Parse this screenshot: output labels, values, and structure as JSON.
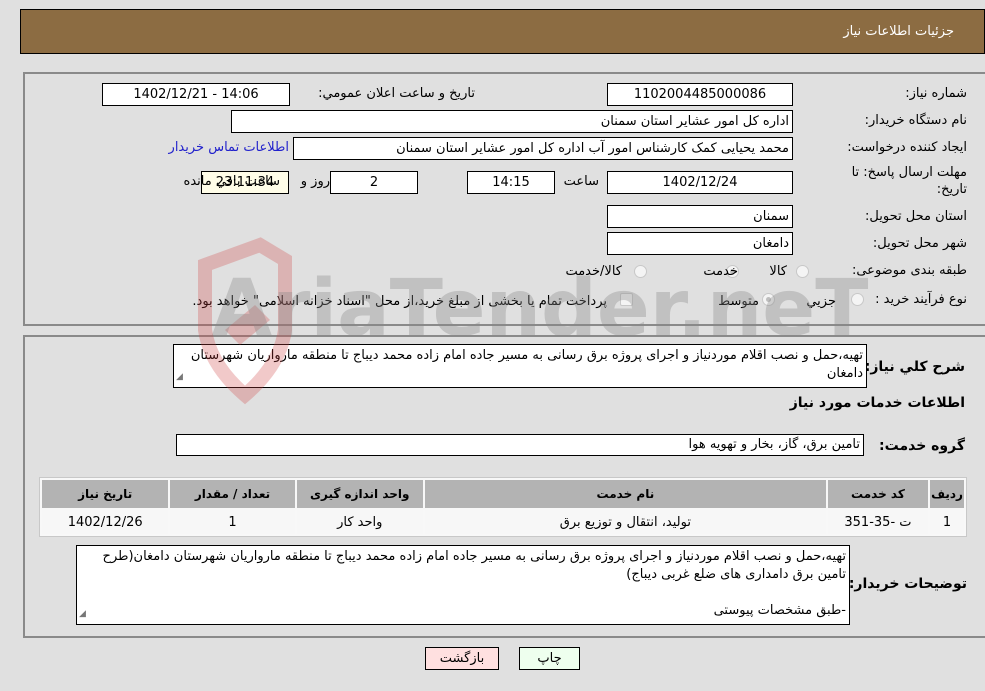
{
  "header": {
    "title": "جزئیات اطلاعات نیاز"
  },
  "colors": {
    "header_bg": "#8c6c42",
    "page_bg": "#e0e0e0",
    "link": "#2222cc",
    "back_button_bg": "#ffe0e0",
    "print_button_bg": "#eeffee",
    "remaining_time_bg": "#fffde8"
  },
  "details": {
    "need_number_label": "شماره نیاز:",
    "need_number": "1102004485000086",
    "announce_label": "تاریخ و ساعت اعلان عمومي:",
    "announce_value": "1402/12/21 - 14:06",
    "buyer_org_label": "نام دستگاه خریدار:",
    "buyer_org": "اداره کل امور عشایر استان سمنان",
    "creator_label": "ایجاد کننده درخواست:",
    "creator": "محمد یحیایی کمک کارشناس امور آب اداره کل امور عشایر استان سمنان",
    "contact_link": "اطلاعات تماس خریدار",
    "deadline_label": "مهلت ارسال پاسخ: تا تاریخ:",
    "deadline_date": "1402/12/24",
    "time_label": "ساعت",
    "deadline_time": "14:15",
    "days": "2",
    "days_label": "روز و",
    "remaining": "23:11:34",
    "remaining_label": "ساعت باقي مانده",
    "province_label": "استان محل تحویل:",
    "province": "سمنان",
    "city_label": "شهر محل تحویل:",
    "city": "دامغان",
    "category_label": "طبقه بندی موضوعی:",
    "category_options": [
      {
        "label": "کالا",
        "checked": false
      },
      {
        "label": "خدمت",
        "checked": true
      },
      {
        "label": "کالا/خدمت",
        "checked": false
      }
    ],
    "process_label": "نوع فرآیند خرید :",
    "process_options": [
      {
        "label": "جزيي",
        "checked": false
      },
      {
        "label": "متوسط",
        "checked": true
      }
    ],
    "treasury_note": "پرداخت تمام یا بخشی از مبلغ خرید،از محل \"اسناد خزانه اسلامی\" خواهد بود."
  },
  "description": {
    "label": "شرح كلي نياز:",
    "text": "تهیه،حمل و نصب اقلام موردنیاز و اجرای پروژه برق رسانی به مسیر جاده امام زاده محمد دیباج تا منطقه مارواریان شهرستان دامغان"
  },
  "services": {
    "section_title": "اطلاعات خدمات مورد نیاز",
    "group_label": "گروه خدمت:",
    "group_value": "تامین برق، گاز، بخار و تهویه هوا",
    "columns": [
      "ردیف",
      "کد خدمت",
      "نام خدمت",
      "واحد اندازه گیری",
      "تعداد / مقدار",
      "تاریخ نیاز"
    ],
    "rows": [
      [
        "1",
        "ت -35-351",
        "تولید، انتقال و توزیع برق",
        "واحد کار",
        "1",
        "1402/12/26"
      ]
    ]
  },
  "buyer_notes": {
    "label": "توضیحات خریدار:",
    "line1": "تهیه،حمل و نصب اقلام موردنیاز و اجرای پروژه برق رسانی به مسیر جاده امام زاده محمد دیباج تا منطقه مارواریان شهرستان دامغان(طرح تامین برق دامداری های ضلع غربی دیباج)",
    "line2": "-طبق مشخصات پیوستی"
  },
  "buttons": {
    "print": "چاپ",
    "back": "بازگشت"
  },
  "watermark": {
    "text": "AriaTender.neT"
  }
}
